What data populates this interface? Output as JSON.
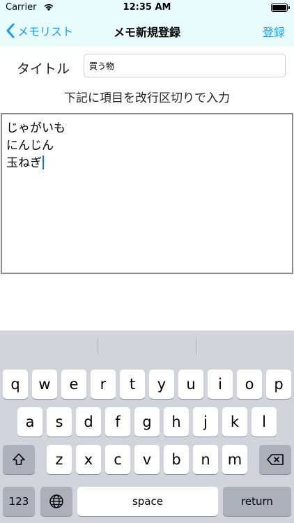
{
  "status_bar": {
    "carrier": "Carrier",
    "time": "12:35 AM"
  },
  "nav": {
    "back_label": "メモリスト",
    "title": "メモ新規登録",
    "action_label": "登録"
  },
  "form": {
    "title_label": "タイトル",
    "title_value": "買う物",
    "instruction": "下記に項目を改行区切りで入力",
    "memo_lines": [
      "じゃがいも",
      "にんじん",
      "玉ねぎ"
    ]
  },
  "keyboard": {
    "row1": [
      "q",
      "w",
      "e",
      "r",
      "t",
      "y",
      "u",
      "i",
      "o",
      "p"
    ],
    "row2": [
      "a",
      "s",
      "d",
      "f",
      "g",
      "h",
      "j",
      "k",
      "l"
    ],
    "row3": [
      "z",
      "x",
      "c",
      "v",
      "b",
      "n",
      "m"
    ],
    "numbers_label": "123",
    "space_label": "space",
    "return_label": "return"
  },
  "colors": {
    "accent": "#1a9df6",
    "nav_bg": "#e9fcfd",
    "keyboard_bg": "#d1d4da"
  }
}
